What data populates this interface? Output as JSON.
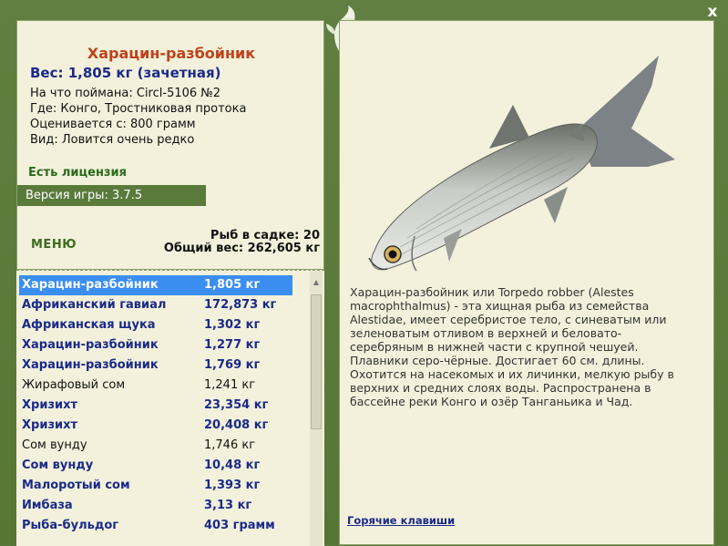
{
  "window": {
    "close_label": "x"
  },
  "catch": {
    "name": "Харацин-разбойник",
    "weight": "Вес: 1,805 кг (зачетная)",
    "caught_with": "На что поймана: Circl-5106 №2",
    "location": "Где: Конго, Тростниковая протока",
    "valued_from": "Оценивается с: 800 грамм",
    "rarity": "Вид: Ловится очень редко",
    "license": "Есть лицензия",
    "version": "Версия игры: 3.7.5"
  },
  "menu_label": "МЕНЮ",
  "stats": {
    "fish_in_keepnet": "Рыб в садке: 20",
    "total_weight": "Общий вес: 262,605 кг"
  },
  "fish_list": [
    {
      "name": "Харацин-разбойник",
      "weight": "1,805 кг"
    },
    {
      "name": "Африканский гавиал",
      "weight": "172,873 кг"
    },
    {
      "name": "Африканская щука",
      "weight": "1,302 кг"
    },
    {
      "name": "Харацин-разбойник",
      "weight": "1,277 кг"
    },
    {
      "name": "Харацин-разбойник",
      "weight": "1,769 кг"
    },
    {
      "name": "Жирафовый сом",
      "weight": "1,241 кг"
    },
    {
      "name": "Хризихт",
      "weight": "23,354 кг"
    },
    {
      "name": "Хризихт",
      "weight": "20,408 кг"
    },
    {
      "name": "Сом вунду",
      "weight": "1,746 кг"
    },
    {
      "name": "Сом вунду",
      "weight": "10,48 кг"
    },
    {
      "name": "Малоротый сом",
      "weight": "1,393 кг"
    },
    {
      "name": "Имбаза",
      "weight": "3,13 кг"
    },
    {
      "name": "Рыба-бульдог",
      "weight": "403 грамм"
    }
  ],
  "description": "Харацин-разбойник или Torpedo robber (Alestes macrophthalmus) - эта хищная рыба из семейства Alestidae, имеет серебристое тело, с синеватым или зеленоватым отливом в верхней и беловато-серебряным в нижней части с крупной чешуей. Плавники серо-чёрные. Достигает 60 см. длины. Охотится на насекомых и их личинки, мелкую рыбу в верхних и средних слоях воды. Распространена в бассейне реки Конго и озёр Танганьика и Чад.",
  "hotkeys_label": "Горячие клавиши"
}
